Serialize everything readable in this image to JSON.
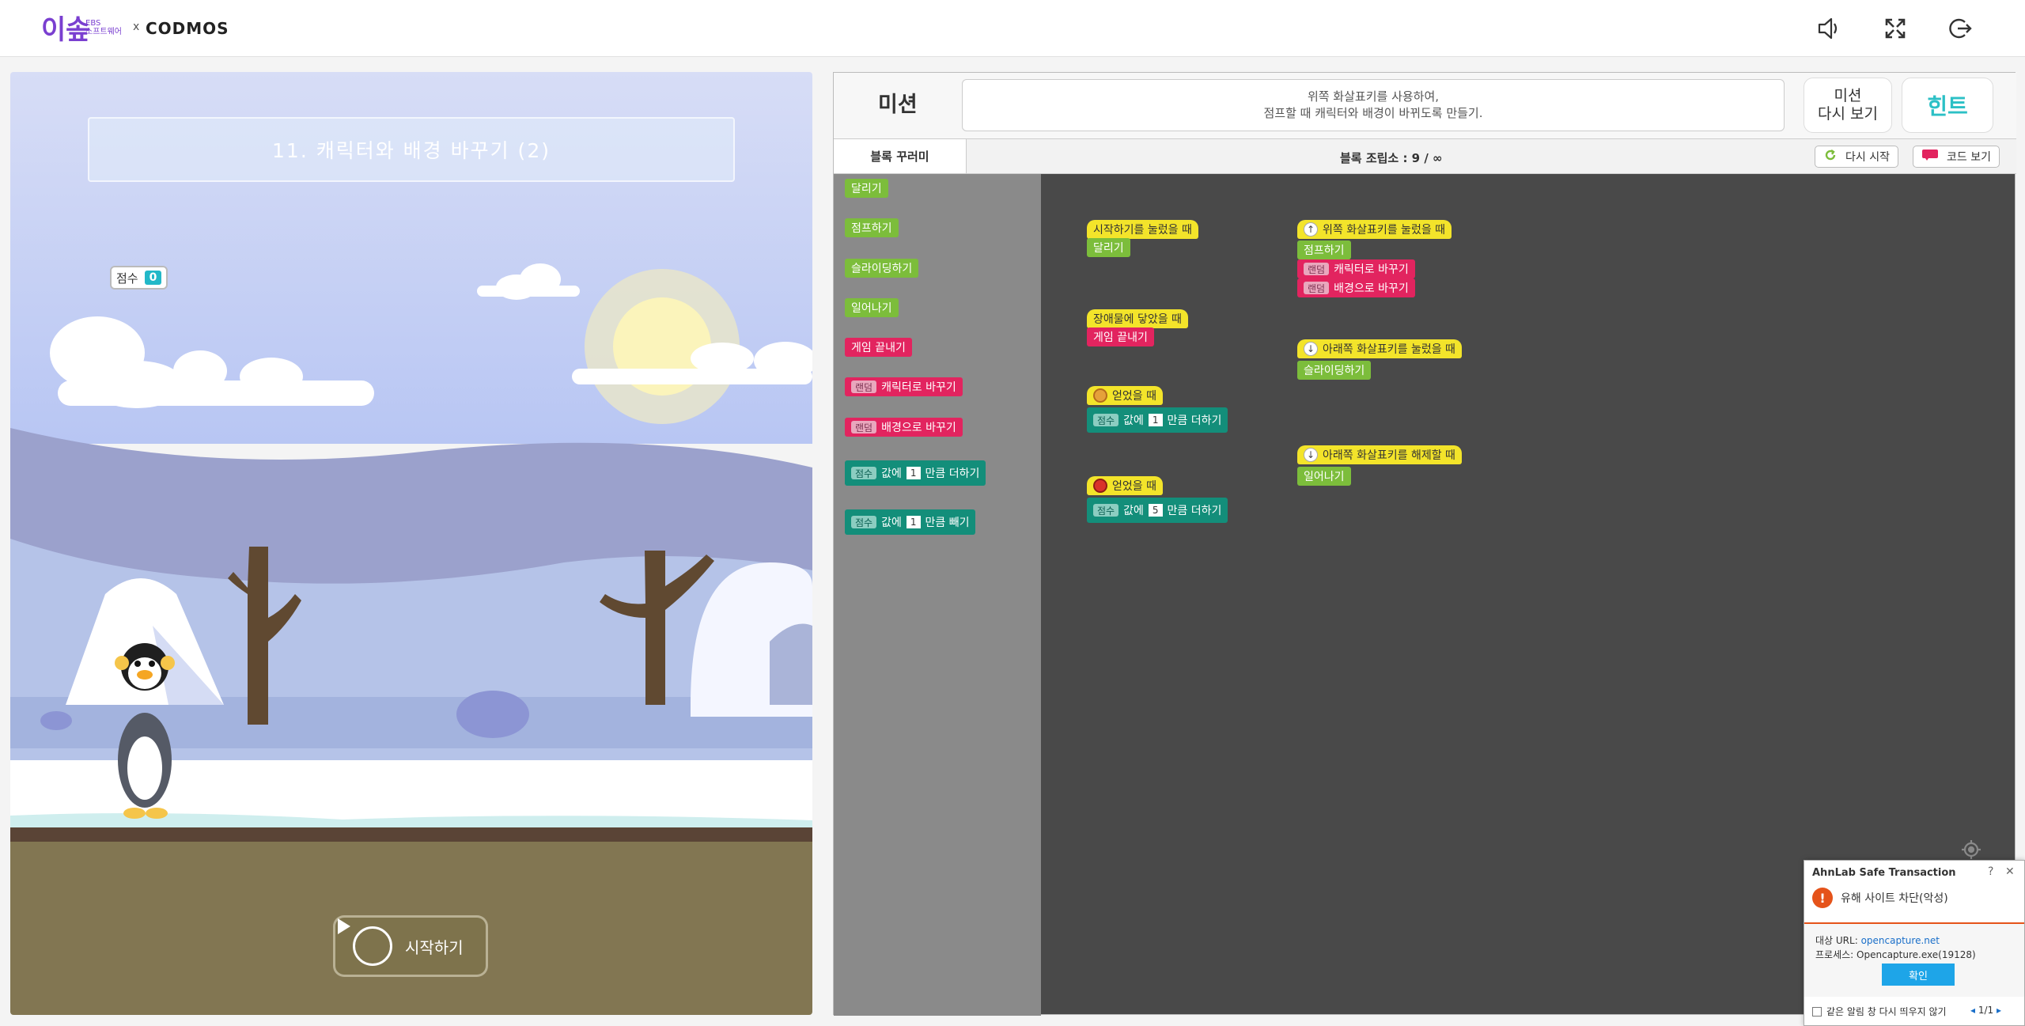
{
  "header": {
    "logo_main": "이솦",
    "logo_sub_1": "EBS",
    "logo_sub_2": "소프트웨어",
    "logo_x": "x",
    "logo_codmos": "CODMOS",
    "icons": [
      "speaker-icon",
      "fullscreen-icon",
      "exit-icon"
    ]
  },
  "stage": {
    "title": "11. 캐릭터와 배경 바꾸기 (2)",
    "score_label": "점수",
    "score_value": "0",
    "start_label": "시작하기"
  },
  "mission": {
    "label": "미션",
    "desc_line1": "위쪽 화살표키를 사용하여,",
    "desc_line2": "점프할 때 캐릭터와 배경이 바뀌도록 만들기.",
    "review_line1": "미션",
    "review_line2": "다시 보기",
    "hint": "힌트"
  },
  "toolbar": {
    "tab": "블록 꾸러미",
    "block_count": "블록 조립소 : 9 / ∞",
    "restart": "다시 시작",
    "code_view": "코드 보기"
  },
  "palette": {
    "run": "달리기",
    "jump": "점프하기",
    "slide": "슬라이딩하기",
    "stand": "일어나기",
    "end_game": "게임 끝내기",
    "random": "랜덤",
    "to_character": "캐릭터로 바꾸기",
    "to_background": "배경으로 바꾸기",
    "score": "점수",
    "value_of": "값에",
    "one": "1",
    "add_by": "만큼 더하기",
    "sub_by": "만큼 빼기"
  },
  "workspace": {
    "on_start": "시작하기를 눌렀을 때",
    "run": "달리기",
    "on_obstacle": "장애물에 닿았을 때",
    "end_game": "게임 끝내기",
    "on_get": "얻었을 때",
    "score": "점수",
    "value_of": "값에",
    "one": "1",
    "five": "5",
    "add_by": "만큼 더하기",
    "on_up_pressed": "위쪽 화살표키를 눌렀을 때",
    "jump": "점프하기",
    "random": "랜덤",
    "to_character": "캐릭터로 바꾸기",
    "to_background": "배경으로 바꾸기",
    "on_down_pressed": "아래쪽 화살표키를 눌렀을 때",
    "slide": "슬라이딩하기",
    "on_down_released": "아래쪽 화살표키를 해제할 때",
    "stand": "일어나기"
  },
  "ahnlab": {
    "title": "AhnLab Safe Transaction",
    "headline": "유해 사이트 차단(악성)",
    "url_label": "대상 URL:",
    "url_value": "opencapture.net",
    "process_label": "프로세스:",
    "process_value": "Opencapture.exe(19128)",
    "ok": "확인",
    "dont_show": "같은 알림 창 다시 띄우지 않기",
    "page": "1/1",
    "help": "?",
    "close": "✕"
  },
  "colors": {
    "event_yellow": "#f3e42a",
    "motion_green": "#7cbd3b",
    "looks_pink": "#e2245f",
    "variable_teal": "#138e7a",
    "hint_cyan": "#2cc0c6",
    "alert_orange": "#e5531a"
  }
}
